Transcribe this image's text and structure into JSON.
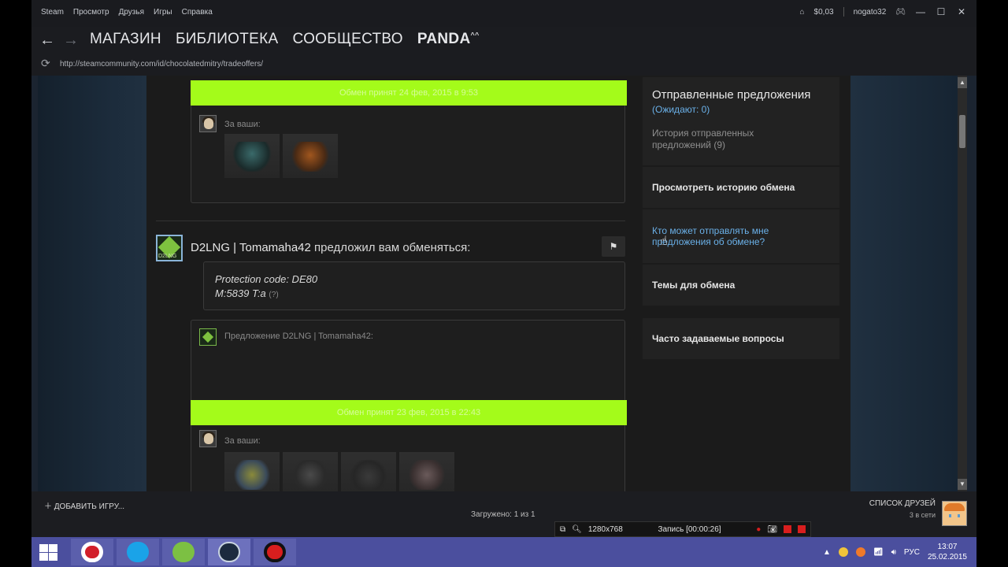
{
  "window": {
    "menu": [
      "Steam",
      "Просмотр",
      "Друзья",
      "Игры",
      "Справка"
    ],
    "wallet": "$0,03",
    "username": "nogato32"
  },
  "nav": {
    "links": [
      "МАГАЗИН",
      "БИБЛИОТЕКА",
      "СООБЩЕСТВО"
    ],
    "user": "PANDA",
    "user_suffix": "^^"
  },
  "url": "http://steamcommunity.com/id/chocolatedmitry/tradeoffers/",
  "trades": {
    "banner1": "Обмен принят 24 фев, 2015 в 9:53",
    "for_yours": "За ваши:",
    "offer_sender": "D2LNG | Tomamaha42",
    "offer_text": "предложил вам обменяться:",
    "message_line1": "Protection code: DE80",
    "message_line2": "M:5839 T:a",
    "message_q": "(?)",
    "proposal_label": "Предложение D2LNG | Tomamaha42:",
    "banner2": "Обмен принят 23 фев, 2015 в 22:43",
    "for_yours2": "За ваши:",
    "avatar_text": "D2LNG"
  },
  "sidebar": {
    "sent_title": "Отправленные предложения",
    "waiting": "(Ожидают: 0)",
    "history": "История отправленных предложений (9)",
    "view_history": "Просмотреть историю обмена",
    "who_can": "Кто может отправлять мне предложения об обмене?",
    "topics": "Темы для обмена",
    "faq": "Часто задаваемые вопросы"
  },
  "bottom": {
    "add_game": "ДОБАВИТЬ ИГРУ...",
    "loaded": "Загружено: 1 из 1",
    "friends": "СПИСОК ДРУЗЕЙ",
    "online": "3 в сети"
  },
  "recorder": {
    "resolution": "1280x768",
    "record": "Запись [00:00:26]"
  },
  "taskbar": {
    "lang": "РУС",
    "time": "13:07",
    "date": "25.02.2015"
  }
}
